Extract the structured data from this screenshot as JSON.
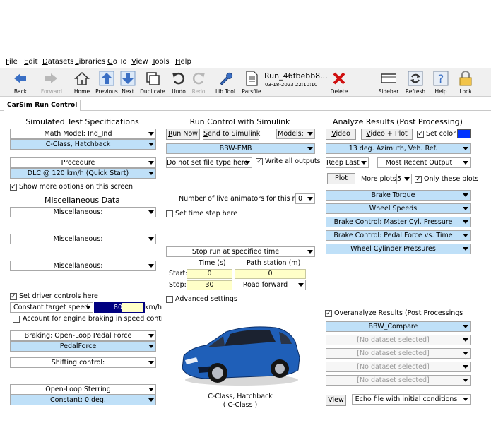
{
  "menu": [
    "File",
    "Edit",
    "Datasets",
    "Libraries",
    "Go To",
    "View",
    "Tools",
    "Help"
  ],
  "toolbar": {
    "back": "Back",
    "forward": "Forward",
    "home": "Home",
    "previous": "Previous",
    "next": "Next",
    "duplicate": "Duplicate",
    "undo": "Undo",
    "redo": "Redo",
    "lib_tool": "Lib Tool",
    "parsfile": "Parsfile",
    "run_name": "Run_46fbebb8...",
    "run_date": "03-18-2023 22:10:10",
    "delete": "Delete",
    "sidebar": "Sidebar",
    "refresh": "Refresh",
    "help": "Help",
    "lock": "Lock"
  },
  "tab": "CarSim Run Control",
  "left": {
    "title": "Simulated Test Specifications",
    "math_model": "Math Model: Ind_Ind",
    "vehicle": "C-Class, Hatchback",
    "procedure_label": "Procedure",
    "procedure": "DLC @ 120 km/h (Quick Start)",
    "show_more": "Show more options on this screen",
    "misc_title": "Miscellaneous Data",
    "misc1": "Miscellaneous:",
    "misc2": "Miscellaneous:",
    "misc3": "Miscellaneous:",
    "set_driver": "Set driver controls here",
    "speed_mode": "Constant target speed",
    "speed_value": "80",
    "speed_unit": "km/h",
    "engine_braking": "Account for engine braking in speed control",
    "braking": "Braking: Open-Loop Pedal Force",
    "pedal_force": "PedalForce",
    "shifting": "Shifting control:",
    "steering": "Open-Loop Sterring",
    "steer_value": "Constant: 0 deg."
  },
  "middle": {
    "title": "Run Control with Simulink",
    "run_now": "Run Now",
    "send": "Send to Simulink",
    "models": "Models:",
    "model_value": "BBW-EMB",
    "file_type": "Do not set file type here",
    "write_outputs": "Write all outputs",
    "animators_label": "Number of live animators for this run:",
    "animators_value": "0",
    "time_step": "Set time step here",
    "stop_run": "Stop run at specified time",
    "time_hdr": "Time (s)",
    "path_hdr": "Path station (m)",
    "start_label": "Start:",
    "start_time": "0",
    "start_path": "0",
    "stop_label": "Stop:",
    "stop_time": "30",
    "road": "Road forward",
    "advanced": "Advanced settings",
    "caption1": "C-Class, Hatchback",
    "caption2": "( C-Class )"
  },
  "right": {
    "title": "Analyze Results (Post Processing)",
    "video": "Video",
    "video_plot": "Video + Plot",
    "set_color": "Set color",
    "color": "#0033ff",
    "azimuth": "13 deg. Azimuth, Veh. Ref.",
    "reep_last": "Reep Last",
    "most_recent": "Most Recent Output",
    "plot": "Plot",
    "more_plots": "More plots:",
    "more_plots_n": "5",
    "only_these": "Only these plots",
    "plots": [
      "Brake Torque",
      "Wheel Speeds",
      "Brake Control: Master Cyl. Pressure",
      "Brake Control: Pedal Force vs. Time",
      "Wheel Cylinder Pressures"
    ],
    "overlay": "Overanalyze Results (Post Processings",
    "compare": "BBW_Compare",
    "no_ds": [
      "[No dataset selected]",
      "[No dataset selected]",
      "[No dataset selected]",
      "[No dataset selected]"
    ],
    "view": "View",
    "echo": "Echo file with initial conditions"
  }
}
